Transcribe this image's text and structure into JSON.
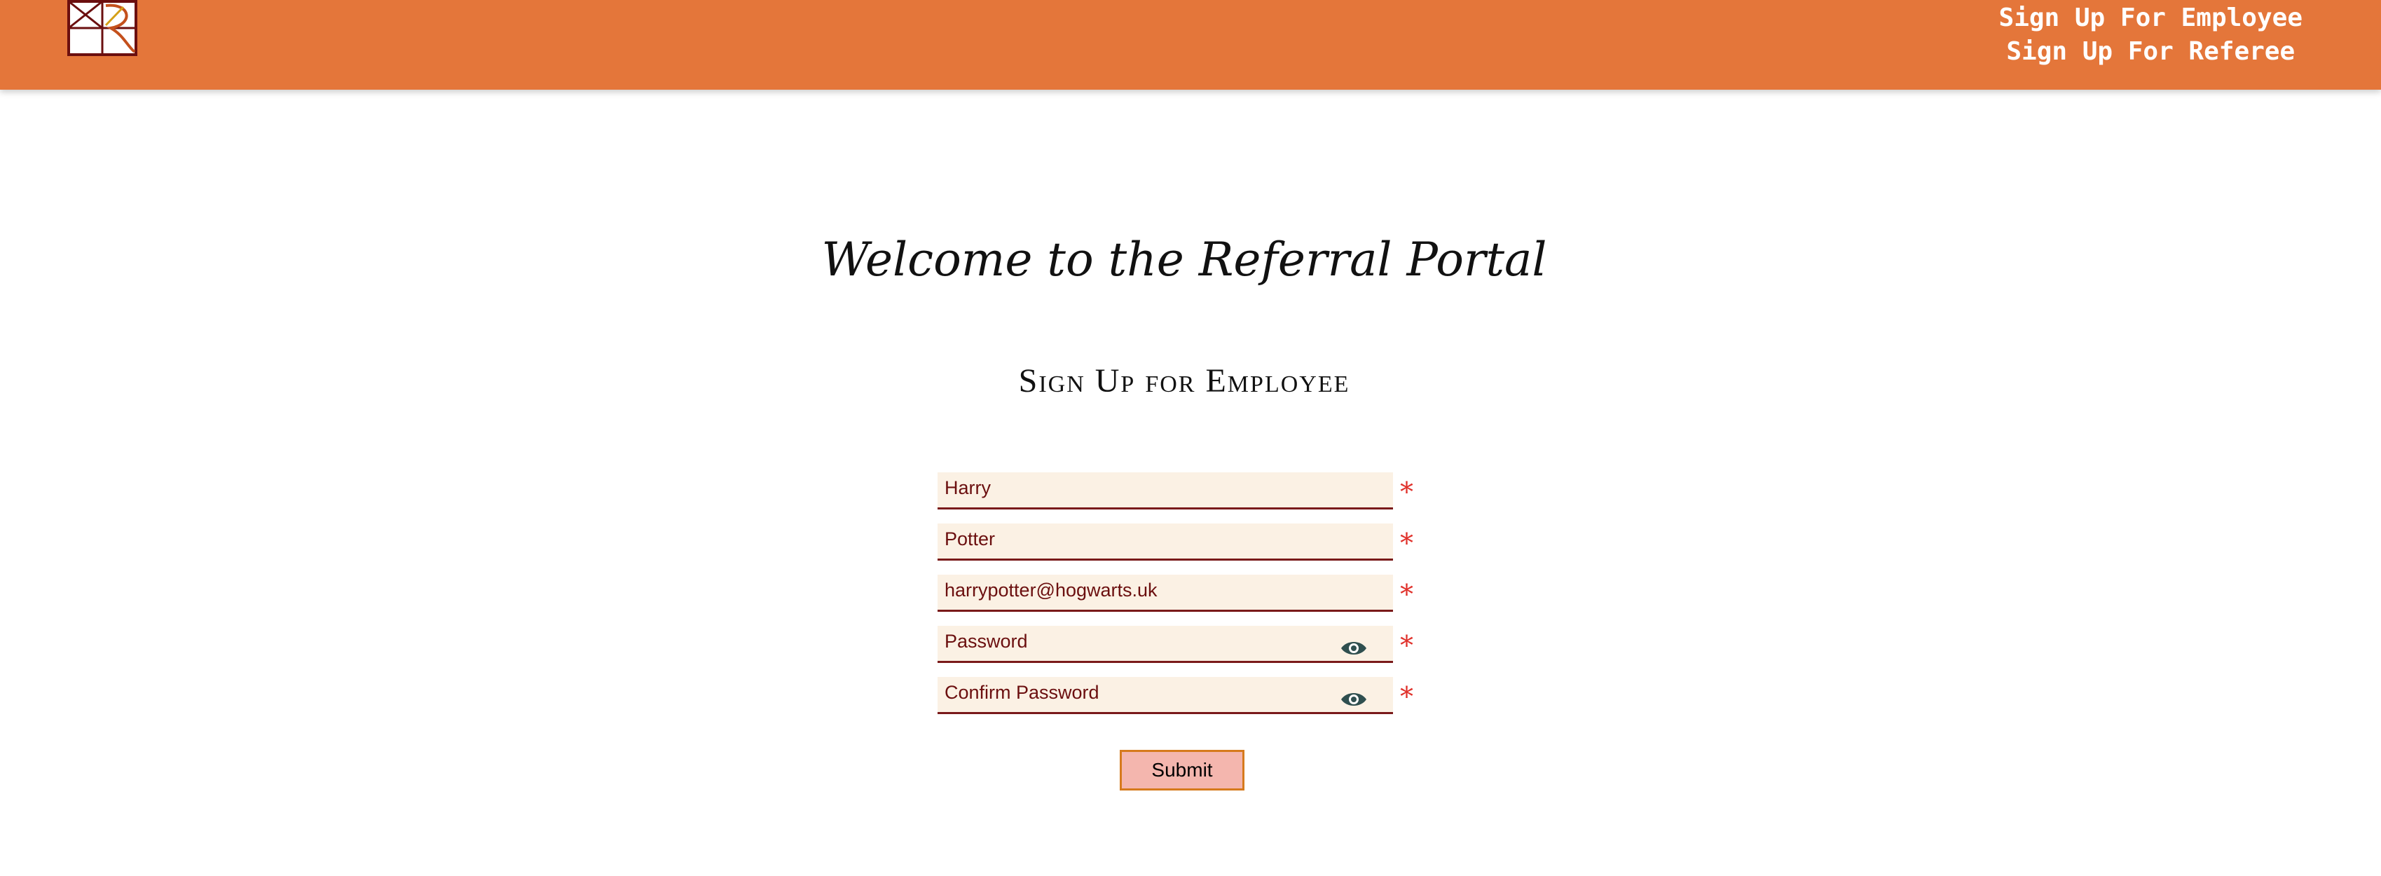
{
  "header": {
    "logo_icon": "referral-portal-logo-icon",
    "nav": {
      "employee_label": "Sign Up For Employee",
      "referee_label": "Sign Up For Referee"
    },
    "bar_color": "#e4763a"
  },
  "main": {
    "welcome_title": "Welcome to the Referral Portal",
    "form_title": "Sign Up for Employee"
  },
  "form": {
    "first_name": {
      "value": "Harry",
      "placeholder": ""
    },
    "last_name": {
      "value": "Potter",
      "placeholder": ""
    },
    "email": {
      "value": "harrypotter@hogwarts.uk",
      "placeholder": ""
    },
    "password": {
      "value": "",
      "placeholder": "Password",
      "icon": "eye-icon"
    },
    "confirm_password": {
      "value": "",
      "placeholder": "Confirm Password",
      "icon": "eye-icon"
    },
    "required_marker": "*",
    "submit_label": "Submit"
  },
  "colors": {
    "field_bg": "#fbf1e4",
    "field_text": "#6b0f0f",
    "required": "#e0312b",
    "submit_bg": "#f4b6ae",
    "submit_border": "#d67a1d"
  }
}
